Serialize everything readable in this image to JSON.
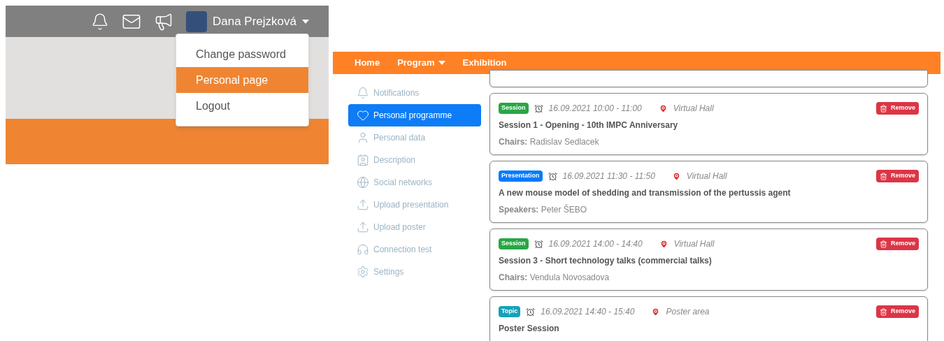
{
  "header": {
    "user_name": "Dana Prejzková"
  },
  "user_menu": [
    {
      "label": "Change password",
      "selected": false
    },
    {
      "label": "Personal page",
      "selected": true
    },
    {
      "label": "Logout",
      "selected": false
    }
  ],
  "nav": [
    {
      "label": "Home",
      "dropdown": false
    },
    {
      "label": "Program",
      "dropdown": true
    },
    {
      "label": "Exhibition",
      "dropdown": false
    }
  ],
  "sidebar": {
    "items": [
      {
        "kind": "bell",
        "label": "Notifications",
        "selected": false
      },
      {
        "kind": "heart",
        "label": "Personal programme",
        "selected": true
      },
      {
        "kind": "user",
        "label": "Personal data",
        "selected": false
      },
      {
        "kind": "description",
        "label": "Description",
        "selected": false
      },
      {
        "kind": "globe",
        "label": "Social networks",
        "selected": false
      },
      {
        "kind": "upload",
        "label": "Upload presentation",
        "selected": false
      },
      {
        "kind": "upload",
        "label": "Upload poster",
        "selected": false
      },
      {
        "kind": "headset",
        "label": "Connection test",
        "selected": false
      },
      {
        "kind": "gear",
        "label": "Settings",
        "selected": false
      }
    ]
  },
  "program": [
    {
      "tag": "Session",
      "color": "#28a745",
      "time": "16.09.2021 10:00 - 11:00",
      "place": "Virtual Hall",
      "title": "Session 1 - Opening - 10th IMPC Anniversary",
      "people": "**Chairs:** Radislav Sedlacek",
      "action": "Remove"
    },
    {
      "tag": "Presentation",
      "color": "#007bff",
      "time": "16.09.2021 11:30 - 11:50",
      "place": "Virtual Hall",
      "title": "A new mouse model of shedding and transmission of the pertussis agent",
      "people": "**Speakers:** Peter ŠEBO",
      "action": "Remove"
    },
    {
      "tag": "Session",
      "color": "#28a745",
      "time": "16.09.2021 14:00 - 14:40",
      "place": "Virtual Hall",
      "title": "Session 3 - Short technology talks (commercial talks)",
      "people": "**Chairs:** Vendula Novosadova",
      "action": "Remove"
    },
    {
      "tag": "Topic",
      "color": "#17a2b8",
      "time": "16.09.2021 14:40 - 15:40",
      "place": "Poster area",
      "title": "Poster Session",
      "action": "Remove"
    }
  ]
}
